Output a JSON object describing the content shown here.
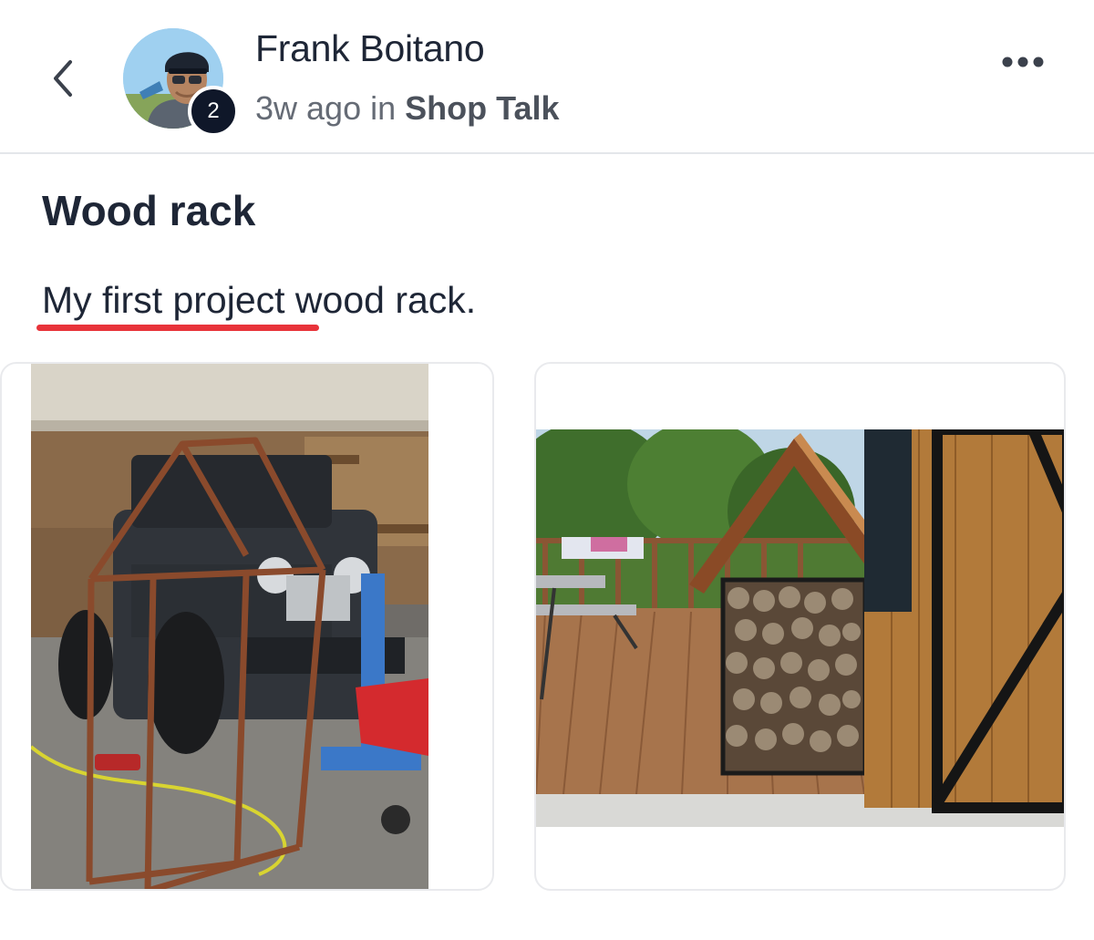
{
  "header": {
    "author_name": "Frank Boitano",
    "time_ago": "3w ago",
    "in_word": "in",
    "space_name": "Shop Talk",
    "avatar_badge": "2",
    "back_icon": "chevron-left-icon",
    "more_icon": "more-horizontal-icon"
  },
  "post": {
    "title": "Wood rack",
    "body": "My first project wood rack.",
    "spellcheck_color": "#e8333a"
  },
  "photos": [
    {
      "subject": "steel frame of a house-shaped wood rack in a garage with a jeep"
    },
    {
      "subject": "finished wood rack with roof filled with firewood on a deck"
    }
  ],
  "colors": {
    "text_primary": "#1e2636",
    "text_secondary": "#656b75",
    "badge_bg": "#0f1729",
    "divider": "#e4e6ea"
  }
}
